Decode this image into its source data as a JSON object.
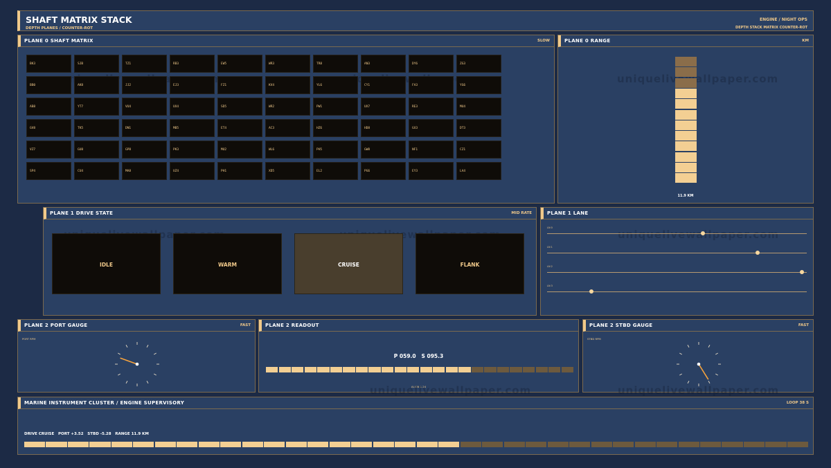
{
  "header": {
    "title": "SHAFT MATRIX STACK",
    "subtitle": "DEPTH PLANES / COUNTER-ROT",
    "right_title": "ENGINE / NIGHT OPS",
    "right_subtitle": "DEPTH STACK  MATRIX  COUNTER-ROT"
  },
  "watermark": "uniquelivewallpaper.com",
  "matrix_panel": {
    "title": "PLANE 0  SHAFT MATRIX",
    "tag": "SLOW",
    "cells": [
      [
        "BK3",
        "SJB",
        "TZ1",
        "RB3",
        "EW5",
        "WR3",
        "TR8",
        "AN3",
        "DY6",
        "ZG3"
      ],
      [
        "BB0",
        "AK8",
        "JJ2",
        "EJ3",
        "FZ1",
        "KV4",
        "YL6",
        "CY1",
        "FA3",
        "YG6"
      ],
      [
        "AB8",
        "YT7",
        "VU4",
        "UX4",
        "SD5",
        "WR2",
        "PW1",
        "UX7",
        "RE3",
        "MU4"
      ],
      [
        "GV8",
        "TK5",
        "DN1",
        "MB5",
        "ET4",
        "AC3",
        "HZ6",
        "HD8",
        "GX3",
        "DT3"
      ],
      [
        "VZ7",
        "GU8",
        "GP8",
        "PK3",
        "MU2",
        "WL6",
        "PH5",
        "GW8",
        "NF1",
        "CZ1"
      ],
      [
        "SP4",
        "CU4",
        "MA8",
        "UZ4",
        "PH1",
        "XD5",
        "EL2",
        "PG6",
        "EY3",
        "LA4"
      ]
    ]
  },
  "range_panel": {
    "title": "PLANE 0  RANGE",
    "tag": "KM",
    "value_label": "11.9 KM",
    "segments_total": 12,
    "segments_lit": 9
  },
  "drive_panel": {
    "title": "PLANE 1  DRIVE STATE",
    "tag": "MID RATE",
    "states": [
      "IDLE",
      "WARM",
      "CRUISE",
      "FLANK"
    ],
    "active_state": "CRUISE"
  },
  "lane_panel": {
    "title": "PLANE 1  LANE",
    "lanes": [
      {
        "label": "LN 0",
        "value": 0.6
      },
      {
        "label": "LN 1",
        "value": 0.81
      },
      {
        "label": "LN 2",
        "value": 0.98
      },
      {
        "label": "LN 3",
        "value": 0.17
      }
    ]
  },
  "port_gauge": {
    "title": "PLANE 2  PORT GAUGE",
    "tag": "FAST",
    "label": "PORT RPM",
    "needle_deg": -70
  },
  "readout_panel": {
    "title": "PLANE 2  READOUT",
    "readout": "P 059.0   S 095.3",
    "align_label": "ALIGN 1.24",
    "segments_total": 24,
    "segments_lit": 16
  },
  "stbd_gauge": {
    "title": "PLANE 2  STBD GAUGE",
    "tag": "FAST",
    "label": "STBD RPM",
    "needle_deg": 148
  },
  "cluster_panel": {
    "title": "MARINE INSTRUMENT CLUSTER  /  ENGINE SUPERVISORY",
    "tag": "LOOP 38 S",
    "status_line": "DRIVE CRUISE   PORT +3.52   STBD -5.28   RANGE 11.9 KM",
    "segments_total": 36,
    "segments_lit": 20
  },
  "colors": {
    "background": "#1c2a45",
    "panel": "#2a4063",
    "accent": "#f0c98a",
    "cell": "#0f0c08",
    "dim": "#6d5a3e"
  }
}
